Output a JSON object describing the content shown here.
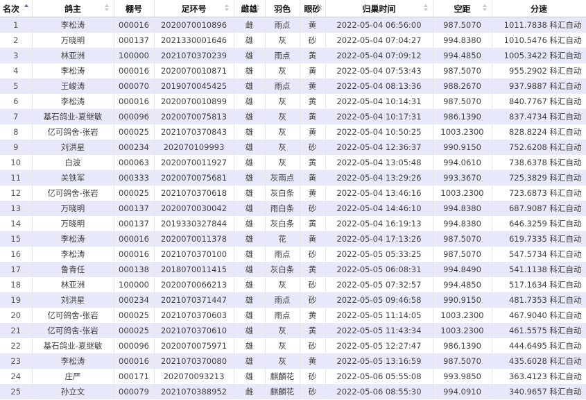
{
  "table": {
    "columns": [
      "名次",
      "鸽主",
      "棚号",
      "足环号",
      "雌雄",
      "羽色",
      "眼砂",
      "归巢时间",
      "空距",
      "分速"
    ],
    "rows": [
      [
        "1",
        "李松涛",
        "000016",
        "2020070010896",
        "雌",
        "雨点",
        "黄",
        "2022-05-04 06:56:00",
        "987.5070",
        "1011.7838 科汇自动"
      ],
      [
        "2",
        "万晓明",
        "000137",
        "2021330001646",
        "雄",
        "灰",
        "砂",
        "2022-05-04 07:04:27",
        "994.8380",
        "1010.5476 科汇自动"
      ],
      [
        "3",
        "林亚洲",
        "100000",
        "2021070370239",
        "雄",
        "雨点",
        "黄",
        "2022-05-04 07:09:12",
        "994.4850",
        "1005.3422 科汇自动"
      ],
      [
        "4",
        "李松涛",
        "000016",
        "2020070010871",
        "雄",
        "灰",
        "黄",
        "2022-05-04 07:53:43",
        "987.5070",
        "955.2902 科汇自动"
      ],
      [
        "5",
        "王峻涛",
        "000070",
        "2019070045425",
        "雄",
        "雨点",
        "黄",
        "2022-05-04 08:13:36",
        "988.2670",
        "937.9887 科汇自动"
      ],
      [
        "6",
        "李松涛",
        "000016",
        "2020070010899",
        "雄",
        "灰",
        "黄",
        "2022-05-04 10:14:31",
        "987.5070",
        "840.7767 科汇自动"
      ],
      [
        "7",
        "基石鸽业-夏继敏",
        "000096",
        "2020070075813",
        "雄",
        "灰",
        "黄",
        "2022-05-04 10:17:31",
        "986.1390",
        "837.4734 科汇自动"
      ],
      [
        "8",
        "亿可鸽舍-张岩",
        "000025",
        "2021070370843",
        "雄",
        "灰",
        "黄",
        "2022-05-04 10:50:25",
        "1003.2300",
        "828.8224 科汇自动"
      ],
      [
        "9",
        "刘洪星",
        "000234",
        "202070109993",
        "雄",
        "灰",
        "砂",
        "2022-05-04 12:36:37",
        "990.9150",
        "752.6208 科汇自动"
      ],
      [
        "10",
        "白波",
        "000063",
        "2020070011927",
        "雄",
        "灰",
        "黄",
        "2022-05-04 13:05:48",
        "994.0610",
        "738.6378 科汇自动"
      ],
      [
        "11",
        "关铁军",
        "000333",
        "2020070075681",
        "雄",
        "灰雨点",
        "黄",
        "2022-05-04 13:29:26",
        "993.3670",
        "725.3829 科汇自动"
      ],
      [
        "12",
        "亿可鸽舍-张岩",
        "000025",
        "2021070370618",
        "雄",
        "灰白条",
        "黄",
        "2022-05-04 13:46:16",
        "1003.2300",
        "723.6873 科汇自动"
      ],
      [
        "13",
        "万晓明",
        "000137",
        "2020070030042",
        "雄",
        "雨白条",
        "砂",
        "2022-05-04 14:46:10",
        "994.8380",
        "687.9087 科汇自动"
      ],
      [
        "14",
        "万晓明",
        "000137",
        "2019330327844",
        "雄",
        "灰白条",
        "黄",
        "2022-05-04 16:19:13",
        "994.8380",
        "646.3259 科汇自动"
      ],
      [
        "15",
        "李松涛",
        "000016",
        "2020070011378",
        "雄",
        "花",
        "黄",
        "2022-05-04 17:13:26",
        "987.5070",
        "619.7335 科汇自动"
      ],
      [
        "16",
        "李松涛",
        "000016",
        "2021070370100",
        "雄",
        "雨点",
        "砂",
        "2022-05-05 05:33:25",
        "987.5070",
        "547.5734 科汇自动"
      ],
      [
        "17",
        "鲁青任",
        "000138",
        "2018070011415",
        "雄",
        "灰白条",
        "黄",
        "2022-05-05 06:08:31",
        "994.8490",
        "541.1138 科汇自动"
      ],
      [
        "18",
        "林亚洲",
        "100000",
        "2020070066213",
        "雄",
        "灰",
        "砂",
        "2022-05-05 07:32:57",
        "994.4850",
        "517.1634 科汇自动"
      ],
      [
        "19",
        "刘洪星",
        "000234",
        "2021070371447",
        "雄",
        "雨点",
        "砂",
        "2022-05-05 09:46:58",
        "990.9150",
        "481.7353 科汇自动"
      ],
      [
        "20",
        "亿可鸽舍-张岩",
        "000025",
        "2021070370603",
        "雄",
        "雨点",
        "黄",
        "2022-05-05 11:14:05",
        "1003.2300",
        "467.9040 科汇自动"
      ],
      [
        "21",
        "亿可鸽舍-张岩",
        "000025",
        "2021070370610",
        "雄",
        "灰",
        "黄",
        "2022-05-05 11:43:34",
        "1003.2300",
        "461.5575 科汇自动"
      ],
      [
        "22",
        "基石鸽业-夏继敏",
        "000096",
        "2020070075971",
        "雄",
        "灰",
        "砂",
        "2022-05-05 12:27:47",
        "986.1390",
        "444.6495 科汇自动"
      ],
      [
        "23",
        "李松涛",
        "000016",
        "2021070370080",
        "雄",
        "灰",
        "黄",
        "2022-05-05 13:16:59",
        "987.5070",
        "435.6028 科汇自动"
      ],
      [
        "24",
        "庄严",
        "000171",
        "202070093213",
        "雄",
        "麒麟花",
        "砂",
        "2022-05-06 05:55:08",
        "993.9850",
        "363.4123 科汇自动"
      ],
      [
        "25",
        "孙立文",
        "000079",
        "2021070388952",
        "雌",
        "麒麟花",
        "砂",
        "2022-05-06 08:55:30",
        "994.0910",
        "340.9657 科汇自动"
      ]
    ]
  }
}
